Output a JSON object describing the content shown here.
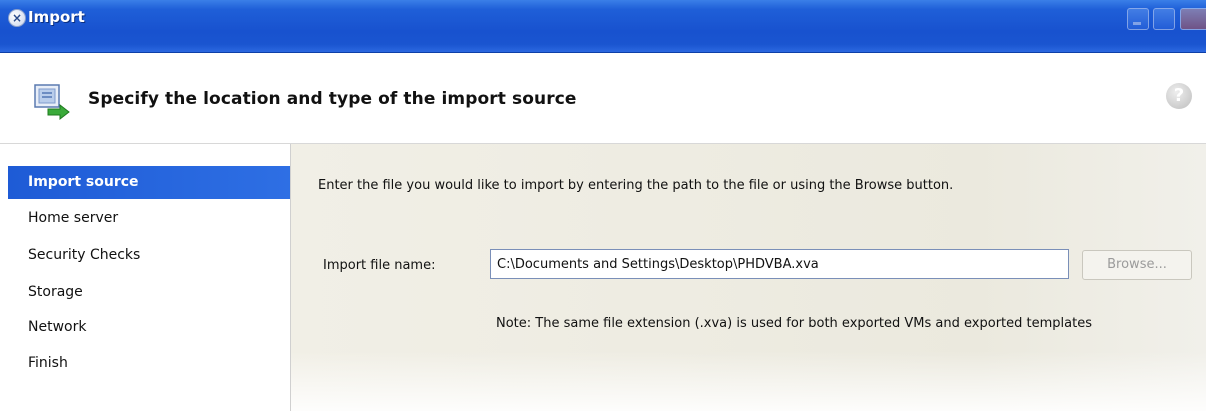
{
  "window": {
    "title": "Import",
    "icon": "wizard-icon"
  },
  "header": {
    "title": "Specify the location and type of the import source",
    "icon": "import-arrow-icon",
    "help_icon": "help-icon"
  },
  "sidebar": {
    "items": [
      {
        "label": "Import source",
        "active": true
      },
      {
        "label": "Home server",
        "active": false
      },
      {
        "label": "Security Checks",
        "active": false
      },
      {
        "label": "Storage",
        "active": false
      },
      {
        "label": "Network",
        "active": false
      },
      {
        "label": "Finish",
        "active": false
      }
    ]
  },
  "main": {
    "instructions": "Enter the file you would like to import by entering the path to the file or using the Browse button.",
    "file_label": "Import file name:",
    "file_value": "C:\\Documents and Settings\\Desktop\\PHDVBA.xva",
    "browse_label": "Browse...",
    "note": "Note: The same file extension (.xva) is used for both exported VMs and exported templates"
  },
  "colors": {
    "titlebar": "#1f5fd8",
    "nav_active": "#2463dc",
    "panel_bg": "#eeece2"
  }
}
